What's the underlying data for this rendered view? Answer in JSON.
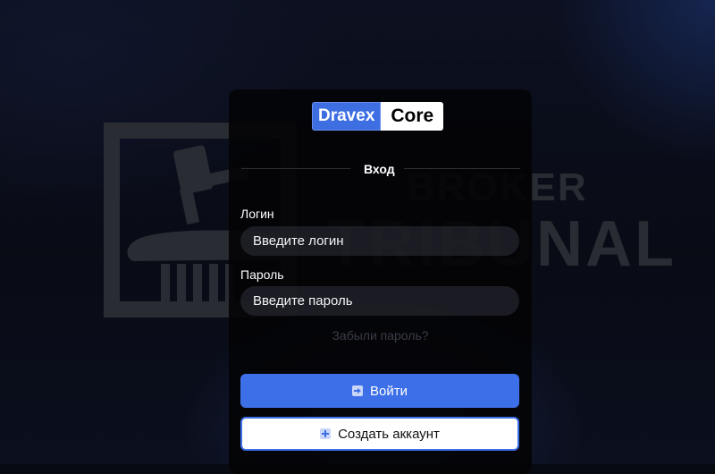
{
  "background": {
    "watermark_line1": "BROKER",
    "watermark_line2": "TRIBUNAL"
  },
  "logo": {
    "part1": "Dravex",
    "part2": "Core"
  },
  "tabs": {
    "login": "Вход"
  },
  "form": {
    "login_label": "Логин",
    "login_placeholder": "Введите логин",
    "password_label": "Пароль",
    "password_placeholder": "Введите пароль",
    "forgot_link": "Забыли пароль?"
  },
  "buttons": {
    "login": "Войти",
    "login_icon": "login-icon",
    "register": "Создать аккаунт",
    "register_icon": "plus-icon"
  },
  "colors": {
    "accent": "#3d6fe8",
    "card": "#040406"
  }
}
